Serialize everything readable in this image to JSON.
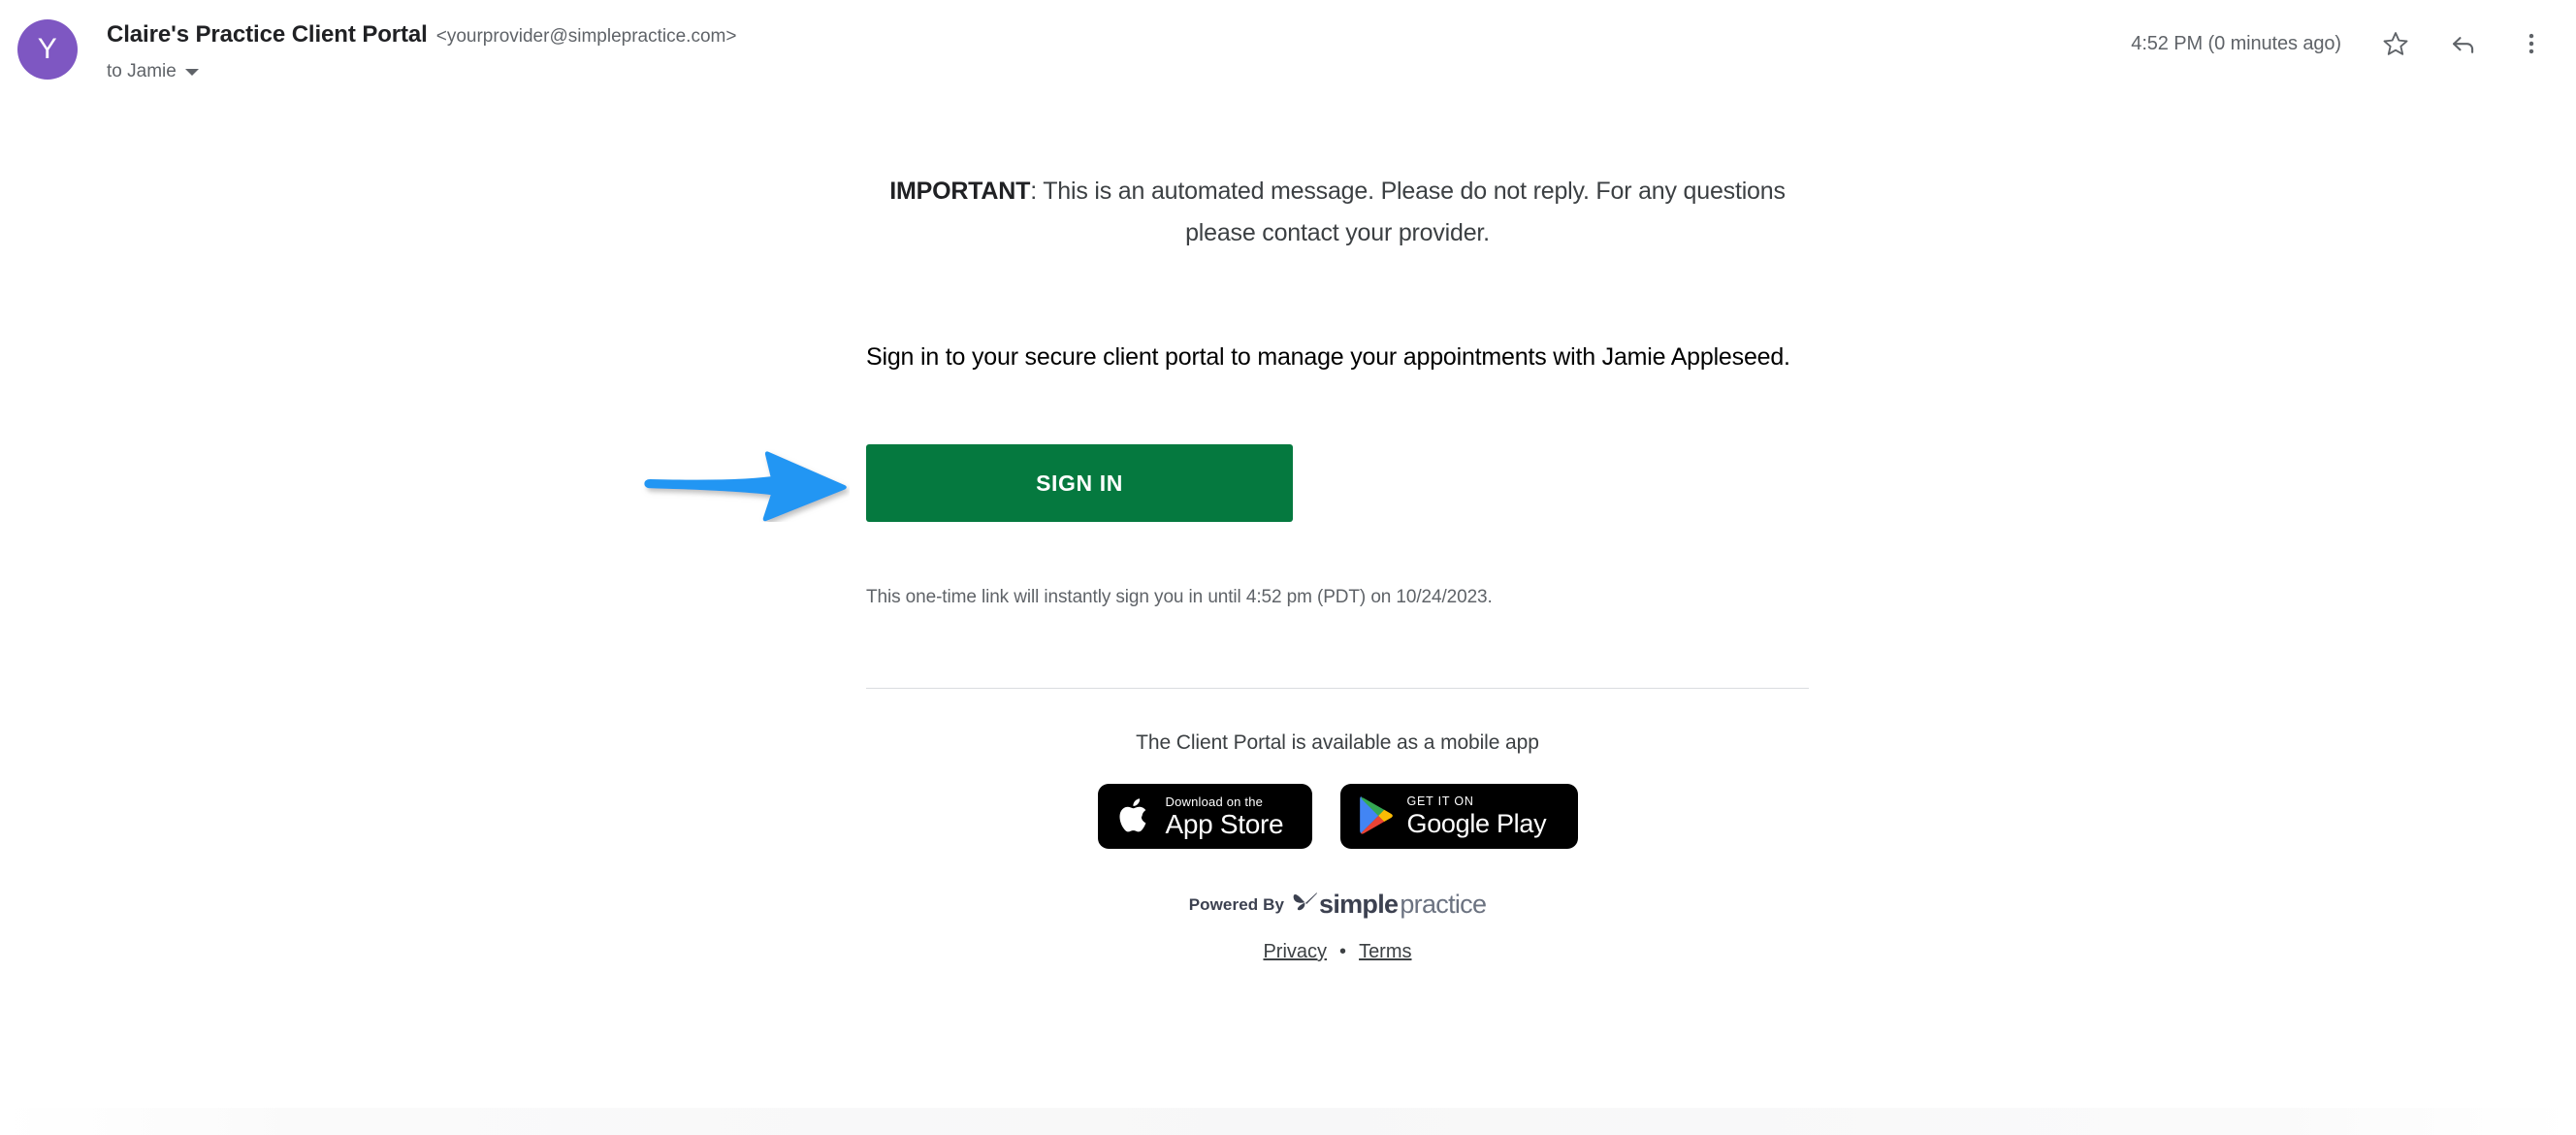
{
  "header": {
    "avatar_initial": "Y",
    "sender_name": "Claire's Practice Client Portal",
    "sender_email": "<yourprovider@simplepractice.com>",
    "recipient": "to Jamie",
    "timestamp": "4:52 PM (0 minutes ago)",
    "icons": {
      "star": "star-icon",
      "reply": "reply-icon",
      "more": "more-vertical-icon",
      "expand": "chevron-down-icon"
    }
  },
  "body": {
    "important_label": "IMPORTANT",
    "important_rest": ": This is an automated message. Please do not reply. For any questions please contact your provider.",
    "signin_paragraph": "Sign in to your secure client portal to manage your appointments with Jamie Appleseed.",
    "signin_button_label": "SIGN IN",
    "fineprint": "This one-time link will instantly sign you in until 4:52 pm (PDT) on 10/24/2023.",
    "annotation": "blue-arrow-pointing-to-sign-in-button"
  },
  "footer": {
    "mobile_text": "The Client Portal is available as a mobile app",
    "app_store": {
      "small": "Download on the",
      "big": "App Store",
      "icon": "apple-logo-icon"
    },
    "google_play": {
      "small": "GET IT ON",
      "big": "Google Play",
      "icon": "google-play-icon"
    },
    "powered_by": "Powered By",
    "brand_bold": "simple",
    "brand_light": "practice",
    "brand_icon": "simplepractice-butterfly-icon",
    "links": {
      "privacy": "Privacy",
      "separator": "•",
      "terms": "Terms"
    }
  },
  "colors": {
    "avatar_purple": "#7e57c2",
    "button_green": "#05793f",
    "arrow_blue": "#2196f3",
    "text_primary": "#202124",
    "text_secondary": "#5f6368",
    "divider": "#dadce0"
  }
}
